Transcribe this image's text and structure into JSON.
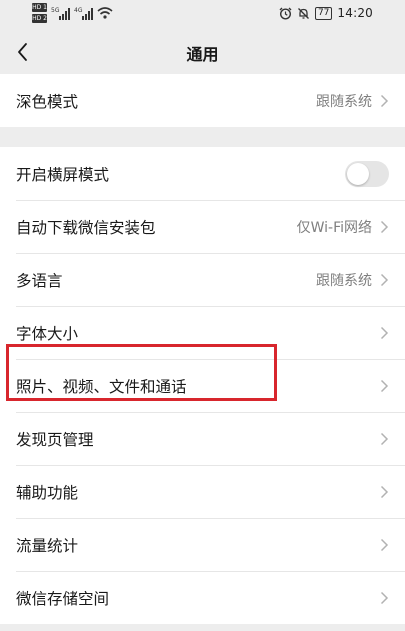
{
  "status_bar": {
    "hd1": "HD 1",
    "hd2": "HD 2",
    "net1": "5G",
    "net2": "4G",
    "battery": "77",
    "time": "14:20"
  },
  "header": {
    "title": "通用"
  },
  "groups": {
    "first": [
      {
        "label": "深色模式",
        "value": "跟随系统"
      }
    ],
    "second": [
      {
        "label": "开启横屏模式",
        "toggle": false
      },
      {
        "label": "自动下载微信安装包",
        "value": "仅Wi-Fi网络"
      },
      {
        "label": "多语言",
        "value": "跟随系统"
      },
      {
        "label": "字体大小"
      },
      {
        "label": "照片、视频、文件和通话",
        "highlighted": true
      },
      {
        "label": "发现页管理"
      },
      {
        "label": "辅助功能"
      },
      {
        "label": "流量统计"
      },
      {
        "label": "微信存储空间"
      }
    ]
  },
  "colors": {
    "background": "#ededed",
    "highlight": "#d8262d",
    "secondary_text": "#7f7f7f"
  }
}
